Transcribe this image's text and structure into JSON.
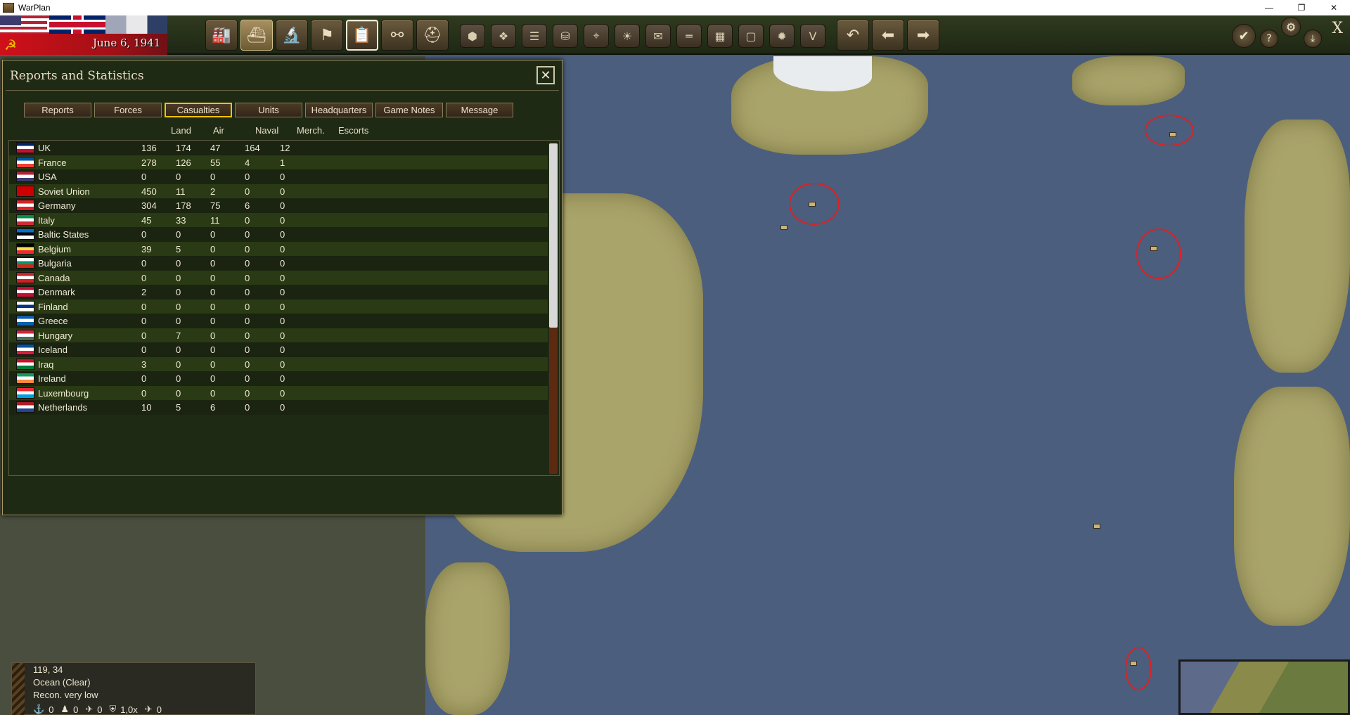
{
  "window": {
    "title": "WarPlan",
    "minimize": "—",
    "restore": "❐",
    "close": "✕"
  },
  "header": {
    "date": "June 6, 1941"
  },
  "toolbar": {
    "main_buttons": [
      "factory-icon",
      "ship-icon",
      "microscope-icon",
      "flag-icon",
      "clipboard-icon",
      "binoculars-icon",
      "helmet-icon"
    ],
    "hex_buttons": [
      "hex-icon",
      "hexes-icon",
      "rail-icon",
      "coins-icon",
      "target-icon",
      "sun-icon",
      "envelope-icon",
      "line-icon",
      "grid-icon",
      "frame-icon",
      "explosion-icon",
      "victory-icon"
    ],
    "nav_buttons": [
      "undo-icon",
      "back-arrow-icon",
      "forward-arrow-icon"
    ],
    "victory_glyph": "V",
    "right": {
      "help": "?",
      "close": "X"
    }
  },
  "dialog": {
    "title": "Reports and Statistics",
    "tabs": [
      {
        "label": "Reports",
        "active": false
      },
      {
        "label": "Forces",
        "active": false
      },
      {
        "label": "Casualties",
        "active": true
      },
      {
        "label": "Units",
        "active": false
      },
      {
        "label": "Headquarters",
        "active": false
      },
      {
        "label": "Game Notes",
        "active": false
      },
      {
        "label": "Message",
        "active": false
      }
    ],
    "columns": [
      "Land",
      "Air",
      "Naval",
      "Merch.",
      "Escorts"
    ],
    "rows": [
      {
        "name": "UK",
        "land": "136",
        "air": "174",
        "naval": "47",
        "merch": "164",
        "escorts": "12"
      },
      {
        "name": "France",
        "land": "278",
        "air": "126",
        "naval": "55",
        "merch": "4",
        "escorts": "1"
      },
      {
        "name": "USA",
        "land": "0",
        "air": "0",
        "naval": "0",
        "merch": "0",
        "escorts": "0"
      },
      {
        "name": "Soviet Union",
        "land": "450",
        "air": "11",
        "naval": "2",
        "merch": "0",
        "escorts": "0"
      },
      {
        "name": "Germany",
        "land": "304",
        "air": "178",
        "naval": "75",
        "merch": "6",
        "escorts": "0"
      },
      {
        "name": "Italy",
        "land": "45",
        "air": "33",
        "naval": "11",
        "merch": "0",
        "escorts": "0"
      },
      {
        "name": "Baltic States",
        "land": "0",
        "air": "0",
        "naval": "0",
        "merch": "0",
        "escorts": "0"
      },
      {
        "name": "Belgium",
        "land": "39",
        "air": "5",
        "naval": "0",
        "merch": "0",
        "escorts": "0"
      },
      {
        "name": "Bulgaria",
        "land": "0",
        "air": "0",
        "naval": "0",
        "merch": "0",
        "escorts": "0"
      },
      {
        "name": "Canada",
        "land": "0",
        "air": "0",
        "naval": "0",
        "merch": "0",
        "escorts": "0"
      },
      {
        "name": "Denmark",
        "land": "2",
        "air": "0",
        "naval": "0",
        "merch": "0",
        "escorts": "0"
      },
      {
        "name": "Finland",
        "land": "0",
        "air": "0",
        "naval": "0",
        "merch": "0",
        "escorts": "0"
      },
      {
        "name": "Greece",
        "land": "0",
        "air": "0",
        "naval": "0",
        "merch": "0",
        "escorts": "0"
      },
      {
        "name": "Hungary",
        "land": "0",
        "air": "7",
        "naval": "0",
        "merch": "0",
        "escorts": "0"
      },
      {
        "name": "Iceland",
        "land": "0",
        "air": "0",
        "naval": "0",
        "merch": "0",
        "escorts": "0"
      },
      {
        "name": "Iraq",
        "land": "3",
        "air": "0",
        "naval": "0",
        "merch": "0",
        "escorts": "0"
      },
      {
        "name": "Ireland",
        "land": "0",
        "air": "0",
        "naval": "0",
        "merch": "0",
        "escorts": "0"
      },
      {
        "name": "Luxembourg",
        "land": "0",
        "air": "0",
        "naval": "0",
        "merch": "0",
        "escorts": "0"
      },
      {
        "name": "Netherlands",
        "land": "10",
        "air": "5",
        "naval": "6",
        "merch": "0",
        "escorts": "0"
      }
    ],
    "flag_colors": {
      "UK": [
        "#012169",
        "#ffffff",
        "#c8102e"
      ],
      "France": [
        "#0055a4",
        "#ffffff",
        "#ef4135"
      ],
      "USA": [
        "#b22234",
        "#ffffff",
        "#3c3b6e"
      ],
      "Soviet Union": [
        "#cc0000",
        "#cc0000",
        "#cc0000"
      ],
      "Germany": [
        "#dd2222",
        "#ffffff",
        "#dd2222"
      ],
      "Italy": [
        "#009246",
        "#ffffff",
        "#ce2b37"
      ],
      "Baltic States": [
        "#0072ce",
        "#000000",
        "#ffffff"
      ],
      "Belgium": [
        "#000000",
        "#fae042",
        "#ed2939"
      ],
      "Bulgaria": [
        "#ffffff",
        "#00966e",
        "#d62612"
      ],
      "Canada": [
        "#cc2222",
        "#ffffff",
        "#cc2222"
      ],
      "Denmark": [
        "#c60c30",
        "#ffffff",
        "#c60c30"
      ],
      "Finland": [
        "#ffffff",
        "#003580",
        "#ffffff"
      ],
      "Greece": [
        "#0d5eaf",
        "#ffffff",
        "#0d5eaf"
      ],
      "Hungary": [
        "#ce2939",
        "#ffffff",
        "#477050"
      ],
      "Iceland": [
        "#02529c",
        "#ffffff",
        "#dc1e35"
      ],
      "Iraq": [
        "#ce1126",
        "#ffffff",
        "#007a3d"
      ],
      "Ireland": [
        "#169b62",
        "#ffffff",
        "#ff883e"
      ],
      "Luxembourg": [
        "#ed2939",
        "#ffffff",
        "#00a1de"
      ],
      "Netherlands": [
        "#ae1c28",
        "#ffffff",
        "#21468b"
      ]
    }
  },
  "info_panel": {
    "coords": "119, 34",
    "terrain": "Ocean (Clear)",
    "recon": "Recon. very low",
    "stats": [
      {
        "icon": "anchor-icon",
        "value": "0"
      },
      {
        "icon": "soldier-icon",
        "value": "0"
      },
      {
        "icon": "plane-icon",
        "value": "0"
      },
      {
        "icon": "shield-icon",
        "value": "1,0x"
      },
      {
        "icon": "fighter-icon",
        "value": "0"
      }
    ]
  }
}
